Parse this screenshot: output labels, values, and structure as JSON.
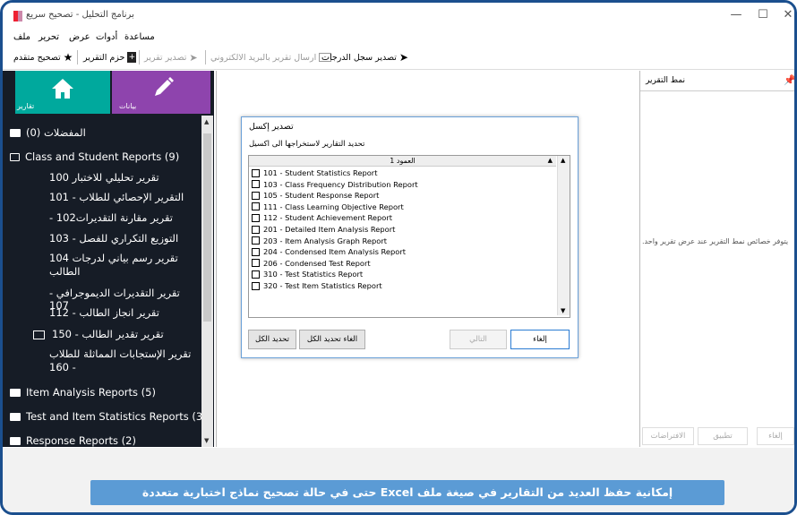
{
  "window": {
    "title": "برنامج التحليل - تصحيح سريع",
    "min_symbol": "—",
    "max_symbol": "☐",
    "close_symbol": "✕"
  },
  "menu": [
    "ملف",
    "تحرير",
    "عرض",
    "أدوات",
    "مساعدة"
  ],
  "toolbar": {
    "export_grades": "تصدير سجل الدرجات",
    "send_email": "ارسال تقرير بالبريد الالكتروني",
    "export_report": "تصدير تقرير",
    "report_bundle": "حزم التقرير",
    "advanced_grading": "تصحيح متقدم"
  },
  "tiles": {
    "reports": "تقارير",
    "data": "بيانات",
    "reports_color": "#00a99d",
    "data_color": "#8e44ad"
  },
  "tree": {
    "favorites": "(0) المفضلات",
    "class_student": "Class and Student Reports (9)",
    "items": [
      "تقرير تحليلي للاختبار 100",
      "التقرير الإحصائي للطلاب - 101",
      "تقرير مقارنة التقديرات102 -",
      "التوزيع التكراري للفصل - 103",
      "تقرير رسم بياني لدرجات 104",
      "الطالب",
      "تقرير التقديرات الديموجرافي - 107",
      "تقرير انجاز الطالب - 112",
      "تقرير تقدير الطالب - 150",
      "تقرير الإستجابات المماثلة للطلاب",
      "160 -"
    ],
    "item_analysis": "Item Analysis Reports (5)",
    "test_item_stats": "Test and Item Statistics Reports (3)",
    "response": "Response Reports (2)"
  },
  "dialog": {
    "title": "تصدير إكسل",
    "subtitle": "تحديد التقارير لاستخراجها الى اكسيل",
    "column_header": "العمود 1",
    "rows": [
      "101 - Student Statistics Report",
      "103 - Class Frequency Distribution Report",
      "105 - Student Response Report",
      "111 - Class Learning Objective Report",
      "112 - Student Achievement Report",
      "201 - Detailed Item Analysis Report",
      "203 - Item Analysis Graph Report",
      "204 - Condensed Item Analysis Report",
      "206 - Condensed Test Report",
      "310 - Test Statistics Report",
      "320 - Test Item Statistics Report"
    ],
    "select_all": "تحديد الكل",
    "deselect_all": "الغاء تحديد الكل",
    "next": "التالي",
    "cancel": "إلغاء"
  },
  "report_style_panel": {
    "title": "نمط التقرير",
    "message": "يتوفر خصائص نمط التقرير عند عرض تقرير واحد.",
    "cancel": "إلغاء",
    "apply": "تطبيق",
    "defaults": "الافتراضات"
  },
  "banner": {
    "text": "إمكانية حفظ العديد من التقارير في صيغة ملف  Excel حتى في حالة تصحيح نماذج اختبارية متعددة",
    "color": "#5b9bd5"
  }
}
